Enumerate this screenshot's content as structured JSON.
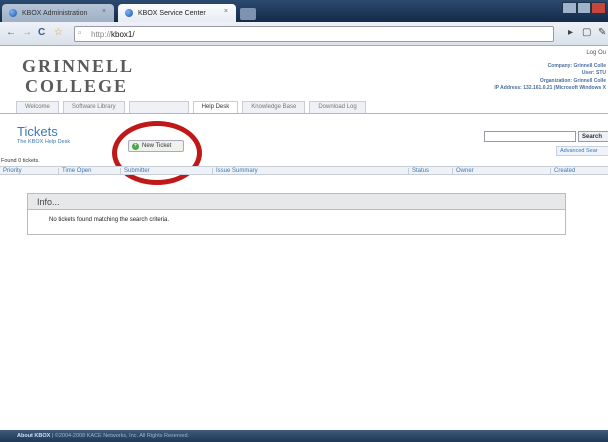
{
  "browser": {
    "tabs": [
      {
        "label": "KBOX Administration",
        "active": false
      },
      {
        "label": "KBOX Service Center",
        "active": true
      }
    ],
    "url_protocol": "http://",
    "url_host": "kbox1/"
  },
  "header": {
    "logo_line1": "GRINNELL",
    "logo_line2": "COLLEGE",
    "logout": "Log Ou",
    "company": "Company: Grinnell Colle",
    "user": "User: STU",
    "organization": "Organization: Grinnell Colle",
    "ip": "IP Address: 132.161.0.21 (Microsoft Windows X"
  },
  "nav": {
    "tabs": [
      {
        "label": "Welcome",
        "active": false
      },
      {
        "label": "Software Library",
        "active": false
      },
      {
        "label": "",
        "active": false
      },
      {
        "label": "Help Desk",
        "active": true
      },
      {
        "label": "Knowledge Base",
        "active": false
      },
      {
        "label": "Download Log",
        "active": false
      }
    ]
  },
  "tickets": {
    "title": "Tickets",
    "subtitle": "The KBOX Help Desk",
    "new_ticket_label": "New Ticket",
    "search_label": "Search",
    "search_value": "",
    "advanced_search_label": "Advanced Sear",
    "found_text": "Found 0 tickets.",
    "columns": [
      "Priority",
      "Time Open",
      "Submitter",
      "Issue Summary",
      "Status",
      "Owner",
      "Created"
    ]
  },
  "info": {
    "title": "Info...",
    "message": "No tickets found matching the search criteria."
  },
  "footer": {
    "about": "About KBOX",
    "copyright": "|  ©2004-2008 KACE Networks, Inc. All Rights Reserved."
  },
  "colors": {
    "accent": "#3c78b4",
    "highlight_circle": "#c01818",
    "footer": "#2c4668"
  }
}
